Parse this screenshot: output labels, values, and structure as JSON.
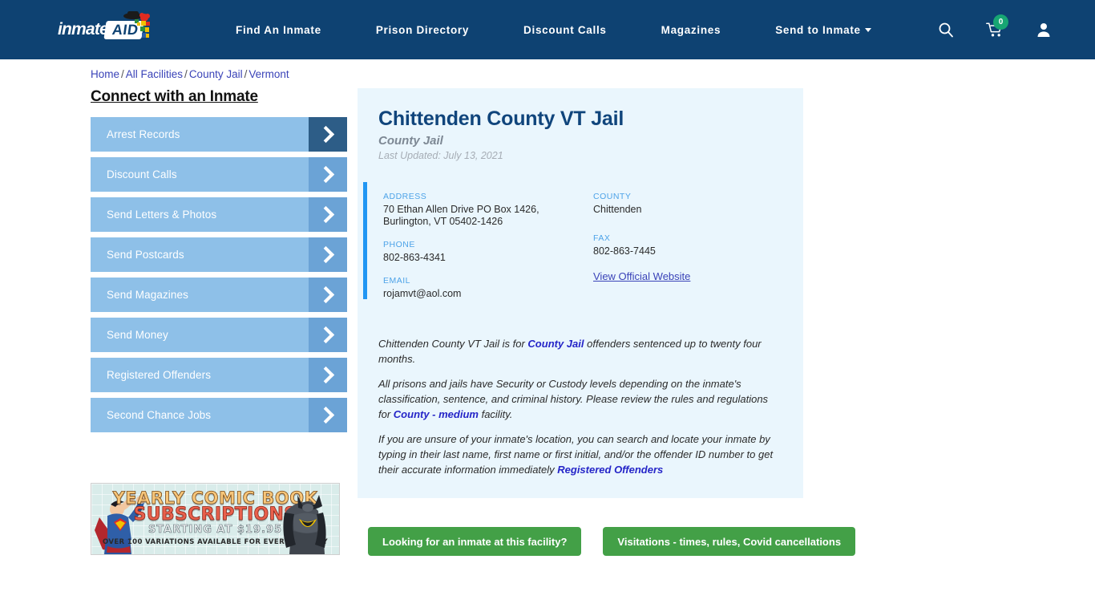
{
  "nav": {
    "brand": {
      "word": "inmate",
      "aid": "AID"
    },
    "links": [
      {
        "label": "Find An Inmate",
        "dropdown": false
      },
      {
        "label": "Prison Directory",
        "dropdown": false
      },
      {
        "label": "Discount Calls",
        "dropdown": false
      },
      {
        "label": "Magazines",
        "dropdown": false
      },
      {
        "label": "Send to Inmate",
        "dropdown": true
      }
    ],
    "icons": {
      "search": "search-icon",
      "cart": "cart-icon",
      "user": "user-icon"
    },
    "cart_count": "0"
  },
  "breadcrumb": {
    "items": [
      "Home",
      "All Facilities",
      "County Jail",
      "Vermont"
    ],
    "separator": "/"
  },
  "sidebar": {
    "title": "Connect with an Inmate",
    "items": [
      {
        "label": "Arrest Records"
      },
      {
        "label": "Discount Calls"
      },
      {
        "label": "Send Letters & Photos"
      },
      {
        "label": "Send Postcards"
      },
      {
        "label": "Send Magazines"
      },
      {
        "label": "Send Money"
      },
      {
        "label": "Registered Offenders"
      },
      {
        "label": "Second Chance Jobs"
      }
    ]
  },
  "ad": {
    "line1": "YEARLY COMIC BOOK",
    "line2": "SUBSCRIPTIONS",
    "line3": "STARTING AT $19.95",
    "line4": "OVER 100 VARIATIONS AVAILABLE FOR EVERY FACILITY"
  },
  "facility": {
    "title": "Chittenden County VT Jail",
    "type": "County Jail",
    "last_updated": "Last Updated: July 13, 2021",
    "info": {
      "address_label": "ADDRESS",
      "address_line1": "70 Ethan Allen Drive PO Box 1426,",
      "address_line2": "Burlington, VT 05402-1426",
      "county_label": "COUNTY",
      "county_value": "Chittenden",
      "phone_label": "PHONE",
      "phone_value": "802-863-4341",
      "fax_label": "FAX",
      "fax_value": "802-863-7445",
      "email_label": "EMAIL",
      "email_value": "rojamvt@aol.com",
      "website_link": "View Official Website"
    },
    "description": {
      "p1_before": "Chittenden County VT Jail is for ",
      "p1_link": "County Jail",
      "p1_after": " offenders sentenced up to twenty four months.",
      "p2_before": "All prisons and jails have Security or Custody levels depending on the inmate's classification, sentence, and criminal history. Please review the rules and regulations for ",
      "p2_link": "County - medium",
      "p2_after": " facility.",
      "p3_before": "If you are unsure of your inmate's location, you can search and locate your inmate by typing in their last name, first name or first initial, and/or the offender ID number to get their accurate information immediately ",
      "p3_link": "Registered Offenders"
    }
  },
  "cta": {
    "inmate_search": "Looking for an inmate at this facility?",
    "visitations": "Visitations - times, rules, Covid cancellations"
  },
  "colors": {
    "nav_bg": "#0e4272",
    "panel_bg": "#eaf6fd",
    "accent_blue": "#2196f3",
    "cta_green": "#43a047",
    "link_blue": "#3a43b8",
    "sidebar_btn": "#8ec0e8"
  }
}
